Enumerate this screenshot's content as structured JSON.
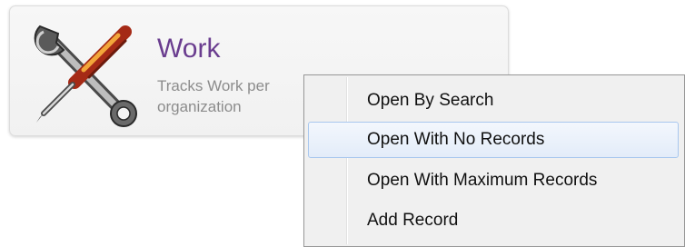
{
  "tile": {
    "icon": "wrench-screwdriver-icon",
    "title": "Work",
    "description": "Tracks Work per",
    "description_line2": "organization"
  },
  "context_menu": {
    "highlighted_item": "Open With No Records",
    "items": [
      {
        "label": "Open By Search"
      },
      {
        "label": "Open With No Records"
      },
      {
        "label": "Open With Maximum Records"
      },
      {
        "label": "Add Record"
      }
    ]
  },
  "colors": {
    "title": "#6a3d8f",
    "description": "#8c8c8c",
    "menu_background": "#f0f0f0",
    "menu_highlight_border": "#a8c7ee"
  }
}
